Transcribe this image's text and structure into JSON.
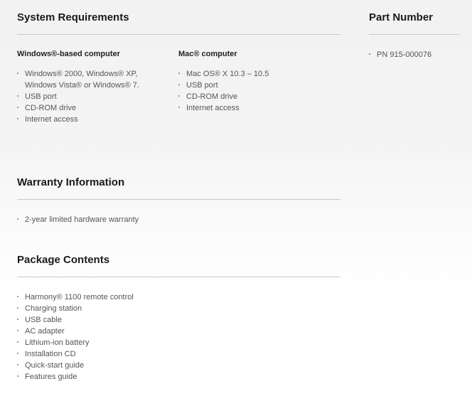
{
  "system_requirements": {
    "title": "System Requirements",
    "windows": {
      "heading": "Windows®-based computer",
      "items": [
        "Windows® 2000, Windows® XP, Windows Vista® or Windows® 7.",
        "USB port",
        "CD-ROM drive",
        "Internet access"
      ]
    },
    "mac": {
      "heading": "Mac® computer",
      "items": [
        "Mac OS® X 10.3 – 10.5",
        "USB port",
        "CD-ROM drive",
        "Internet access"
      ]
    }
  },
  "part_number": {
    "title": "Part Number",
    "items": [
      "PN 915-000076"
    ]
  },
  "warranty": {
    "title": "Warranty Information",
    "items": [
      "2-year limited hardware warranty"
    ]
  },
  "package_contents": {
    "title": "Package Contents",
    "items": [
      "Harmony® 1100 remote control",
      "Charging station",
      "USB cable",
      "AC adapter",
      "Lithium-ion battery",
      "Installation CD",
      "Quick-start guide",
      "Features guide"
    ]
  }
}
